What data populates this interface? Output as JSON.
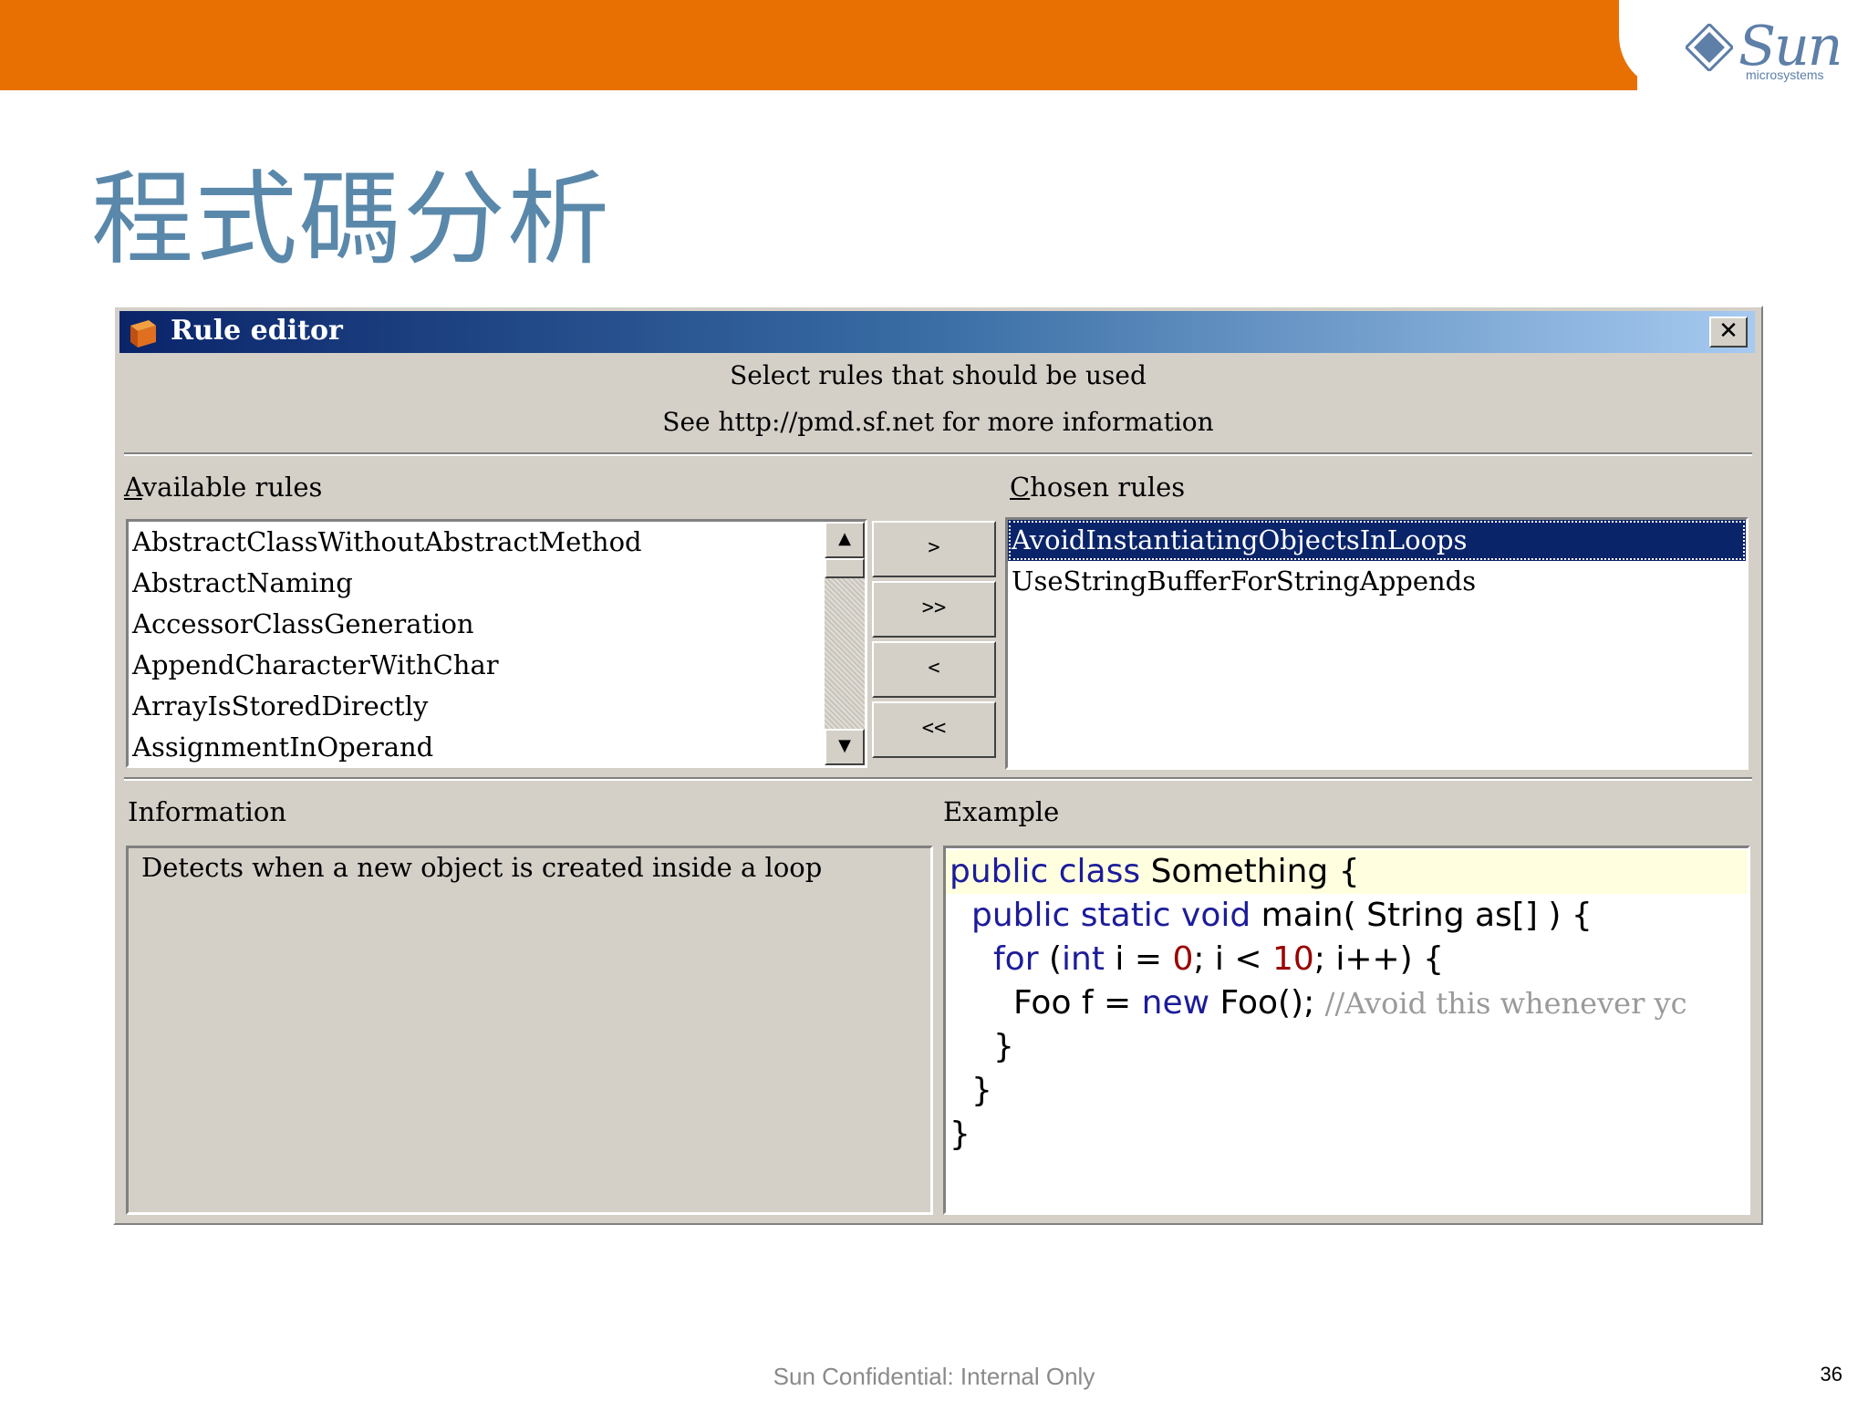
{
  "slide": {
    "title": "程式碼分析",
    "logo_text": "Sun",
    "logo_sub": "microsystems",
    "footer": "Sun Confidential: Internal Only",
    "page_number": "36",
    "accent_color": "#e87003"
  },
  "dialog": {
    "title": "Rule editor",
    "close_label": "✕",
    "header_line1": "Select rules that should be used",
    "header_line2": "See http://pmd.sf.net for more information",
    "available_label_first": "A",
    "available_label_rest": "vailable rules",
    "chosen_label_first": "C",
    "chosen_label_rest": "hosen rules",
    "available_rules": [
      "AbstractClassWithoutAbstractMethod",
      "AbstractNaming",
      "AccessorClassGeneration",
      "AppendCharacterWithChar",
      "ArrayIsStoredDirectly",
      "AssignmentInOperand"
    ],
    "chosen_rules": [
      "AvoidInstantiatingObjectsInLoops",
      "UseStringBufferForStringAppends"
    ],
    "buttons": {
      "add": ">",
      "add_all": ">>",
      "remove": "<",
      "remove_all": "<<"
    },
    "information_label": "Information",
    "information_text": "Detects when a new object is created inside a loop",
    "example_label": "Example",
    "example_code": {
      "l1_kw": "public class",
      "l1_rest": " Something {",
      "l2_kw": "public static void",
      "l2_rest": " main( String as[] ) {",
      "l3_kw1": "for",
      "l3_mid1": " (",
      "l3_kw2": "int",
      "l3_mid2": " i = ",
      "l3_num1": "0",
      "l3_mid3": "; i < ",
      "l3_num2": "10",
      "l3_mid4": "; i++) {",
      "l4_pre": "Foo f = ",
      "l4_kw": "new",
      "l4_post": " Foo(); ",
      "l4_cmt": "//Avoid this whenever yc",
      "l5": "}",
      "l6": "}",
      "l7": "}"
    }
  }
}
